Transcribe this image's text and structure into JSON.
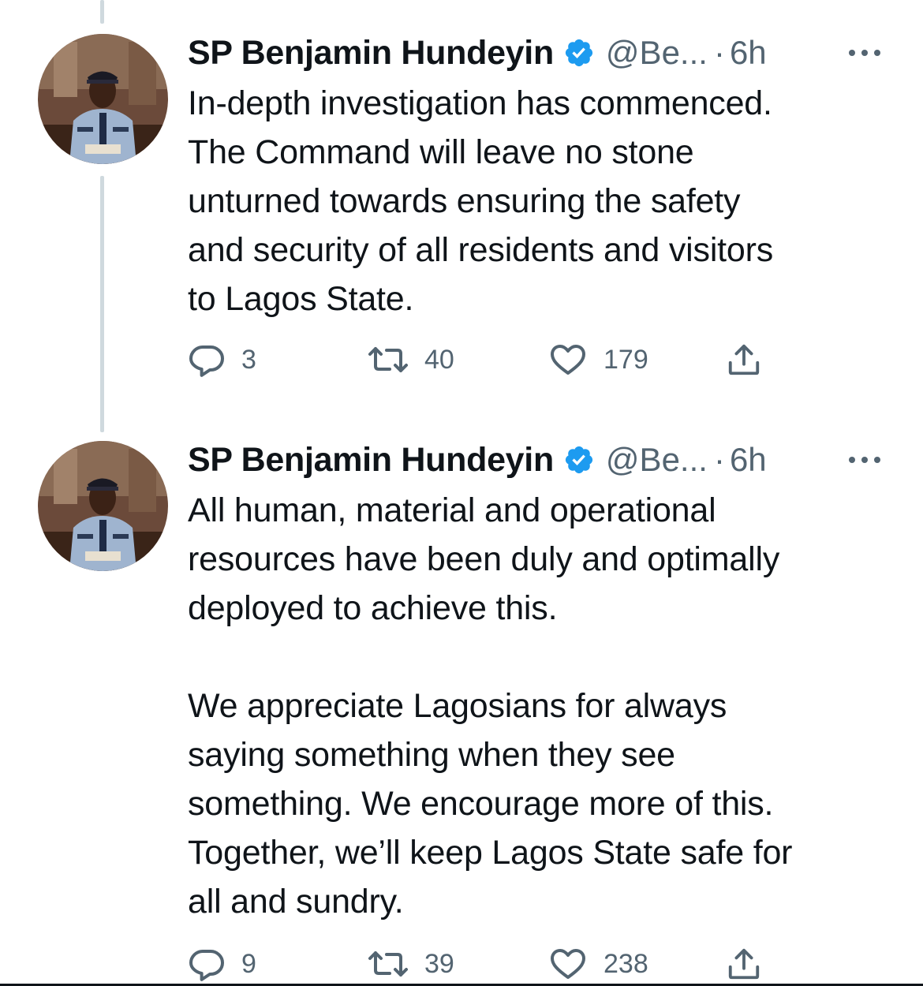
{
  "tweets": [
    {
      "author_name": "SP Benjamin Hundeyin",
      "verified": true,
      "handle": "@Be...",
      "separator": "·",
      "time": "6h",
      "text": "In-depth investigation has commenced.\nThe Command will leave no stone\nunturned towards ensuring the safety\nand security of all residents and visitors\nto Lagos State.",
      "replies": "3",
      "retweets": "40",
      "likes": "179"
    },
    {
      "author_name": "SP Benjamin Hundeyin",
      "verified": true,
      "handle": "@Be...",
      "separator": "·",
      "time": "6h",
      "text": "All human, material and operational\nresources have been duly and optimally\ndeployed to achieve this.\n\nWe appreciate Lagosians for always\nsaying something when they see\nsomething. We encourage more of this.\nTogether, we’ll keep Lagos State safe for\nall and sundry.",
      "replies": "9",
      "retweets": "39",
      "likes": "238"
    }
  ],
  "icons": {
    "reply": "reply-icon",
    "retweet": "retweet-icon",
    "like": "heart-icon",
    "share": "share-icon",
    "verified": "verified-badge-icon",
    "more": "more-icon"
  },
  "colors": {
    "text": "#0f1419",
    "secondary": "#536471",
    "verified": "#1d9bf0",
    "thread_line": "#cfd9de"
  }
}
